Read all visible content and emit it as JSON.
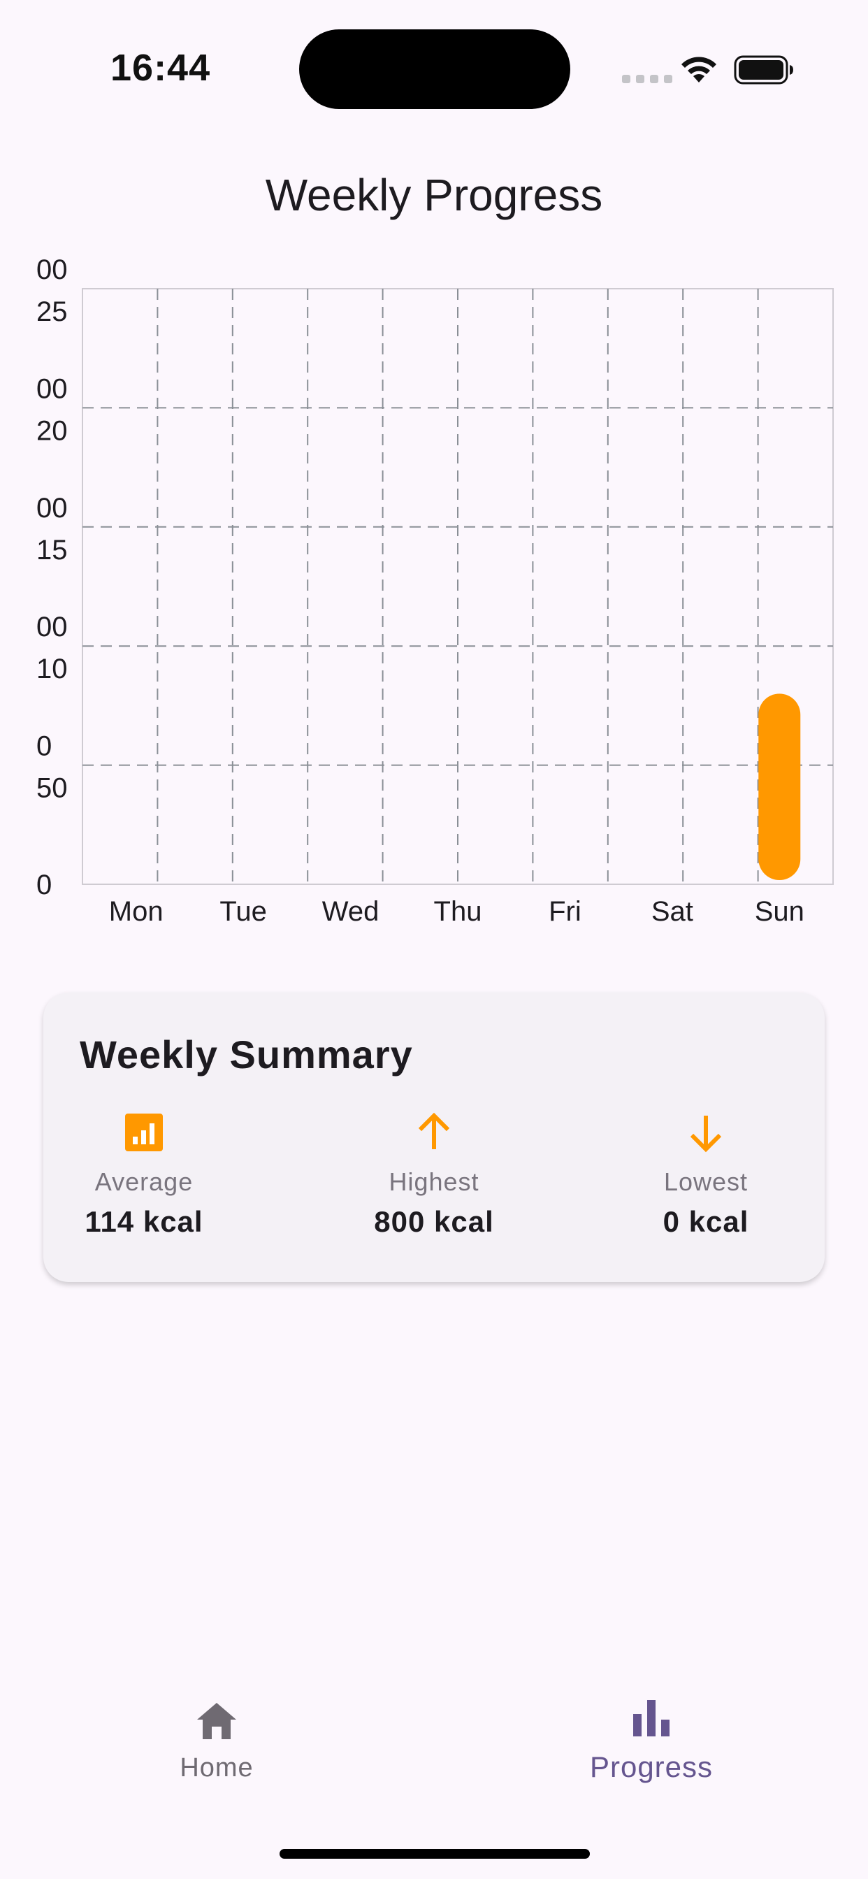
{
  "status_bar": {
    "time": "16:44"
  },
  "page": {
    "title": "Weekly Progress"
  },
  "chart_data": {
    "type": "bar",
    "categories": [
      "Mon",
      "Tue",
      "Wed",
      "Thu",
      "Fri",
      "Sat",
      "Sun"
    ],
    "values": [
      0,
      0,
      0,
      0,
      0,
      0,
      800
    ],
    "ylim": [
      0,
      2500
    ],
    "y_ticks": [
      {
        "value": 0,
        "lines": [
          "0"
        ]
      },
      {
        "value": 500,
        "lines": [
          "50",
          "0"
        ]
      },
      {
        "value": 1000,
        "lines": [
          "10",
          "00"
        ]
      },
      {
        "value": 1500,
        "lines": [
          "15",
          "00"
        ]
      },
      {
        "value": 2000,
        "lines": [
          "20",
          "00"
        ]
      },
      {
        "value": 2500,
        "lines": [
          "25",
          "00"
        ]
      }
    ],
    "grid": true,
    "bar_color": "#ff9800"
  },
  "summary": {
    "title": "Weekly Summary",
    "average": {
      "label": "Average",
      "value": "114 kcal",
      "icon": "bar-chart-icon"
    },
    "highest": {
      "label": "Highest",
      "value": "800 kcal",
      "icon": "arrow-up-icon"
    },
    "lowest": {
      "label": "Lowest",
      "value": "0 kcal",
      "icon": "arrow-down-icon"
    }
  },
  "bottom_nav": {
    "home": {
      "label": "Home",
      "icon": "home-icon",
      "active": false
    },
    "progress": {
      "label": "Progress",
      "icon": "bar-chart-icon",
      "active": true
    }
  },
  "colors": {
    "accent": "#ff9800",
    "nav_active": "#65558f",
    "nav_inactive": "#6f6a72",
    "background": "#fcf7fd"
  }
}
